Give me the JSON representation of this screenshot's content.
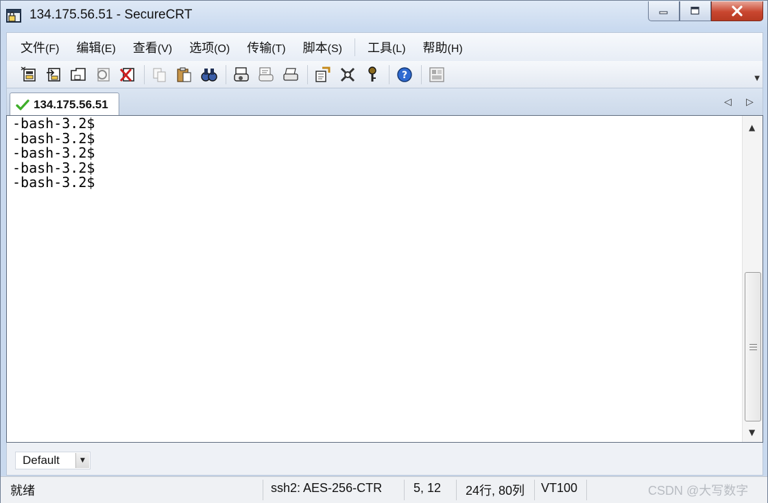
{
  "window": {
    "title": "134.175.56.51 - SecureCRT"
  },
  "menu": [
    {
      "label": "文件",
      "accel": "(F)"
    },
    {
      "label": "编辑",
      "accel": "(E)"
    },
    {
      "label": "查看",
      "accel": "(V)"
    },
    {
      "label": "选项",
      "accel": "(O)"
    },
    {
      "label": "传输",
      "accel": "(T)"
    },
    {
      "label": "脚本",
      "accel": "(S)"
    },
    {
      "label": "工具",
      "accel": "(L)"
    },
    {
      "label": "帮助",
      "accel": "(H)"
    }
  ],
  "toolbar_icons": [
    "connect-icon",
    "quick-connect-icon",
    "connect-in-tab-icon",
    "reconnect-icon",
    "disconnect-icon",
    "copy-icon",
    "paste-icon",
    "find-icon",
    "print-setup-icon",
    "print-selection-icon",
    "print-icon",
    "session-options-icon",
    "global-options-icon",
    "key-icon",
    "help-icon",
    "keymap-icon"
  ],
  "tab": {
    "label": "134.175.56.51",
    "status_color": "#3fae2a"
  },
  "terminal": {
    "lines": [
      "-bash-3.2$",
      "-bash-3.2$",
      "-bash-3.2$",
      "-bash-3.2$",
      "-bash-3.2$"
    ]
  },
  "buttonbar": {
    "session": "Default"
  },
  "status": {
    "ready": "就绪",
    "cipher": "ssh2: AES-256-CTR",
    "cursor": "5,  12",
    "size": "24行, 80列",
    "terminal_type": "VT100",
    "watermark": "CSDN @大写数字"
  },
  "colors": {
    "close_button": "#c9462f",
    "title_gradient_top": "#dfe9f6"
  }
}
